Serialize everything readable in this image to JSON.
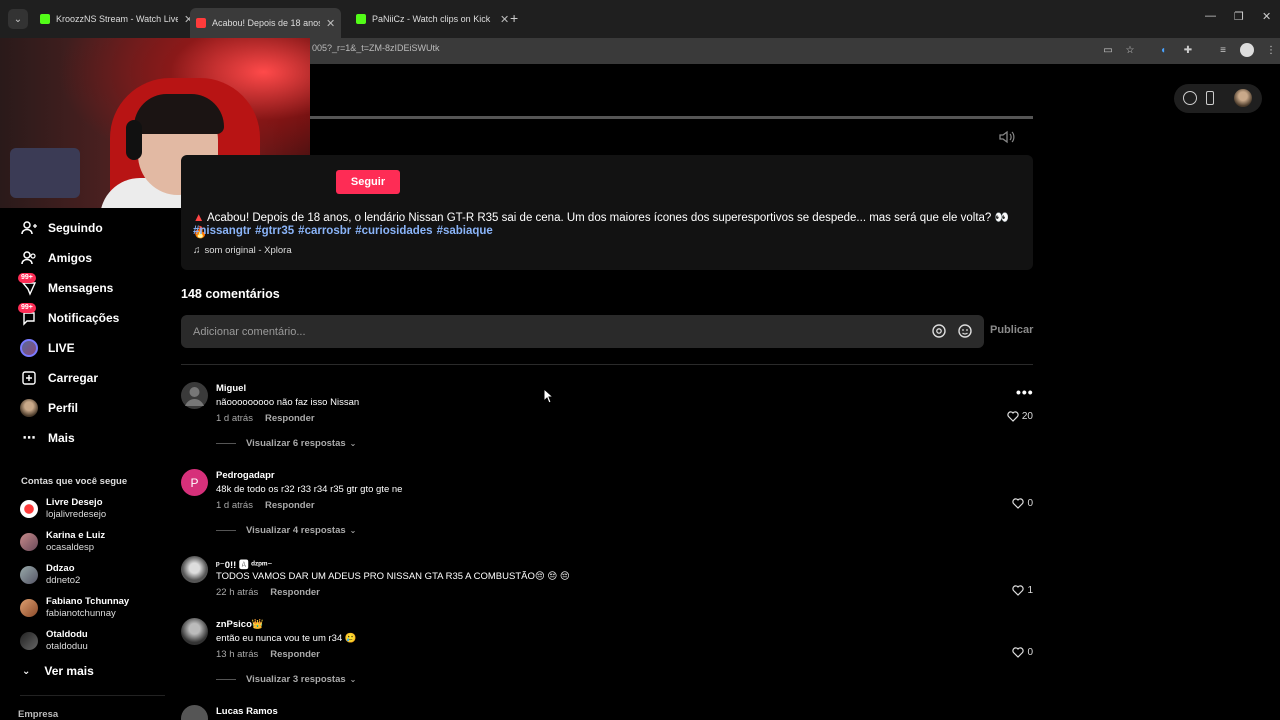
{
  "browser": {
    "tabs": [
      {
        "title": "KroozzNS Stream - Watch Live",
        "favicon_color": "#53fc18"
      },
      {
        "title": "Acabou! Depois de 18 anos",
        "favicon_color": "#ff3b3b"
      },
      {
        "title": "PaNiiCz - Watch clips on Kick",
        "favicon_color": "#53fc18"
      }
    ],
    "url": "005?_r=1&_t=ZM-8zIDEiSWUtk"
  },
  "sidebar": {
    "nav": [
      {
        "label": "Seguindo",
        "icon": "following-icon"
      },
      {
        "label": "Amigos",
        "icon": "friends-icon"
      },
      {
        "label": "Mensagens",
        "icon": "messages-icon",
        "badge": "99+"
      },
      {
        "label": "Notificações",
        "icon": "notifications-icon",
        "badge": "99+"
      },
      {
        "label": "LIVE",
        "icon": "live-icon"
      },
      {
        "label": "Carregar",
        "icon": "upload-icon"
      },
      {
        "label": "Perfil",
        "icon": "profile-icon"
      },
      {
        "label": "Mais",
        "icon": "more-icon"
      }
    ],
    "following_title": "Contas que você segue",
    "following": [
      {
        "name": "Livre Desejo",
        "handle": "lojalivredesejo"
      },
      {
        "name": "Karina e Luiz",
        "handle": "ocasaldesp"
      },
      {
        "name": "Ddzao",
        "handle": "ddneto2"
      },
      {
        "name": "Fabiano Tchunnay",
        "handle": "fabianotchunnay"
      },
      {
        "name": "Otaldodu",
        "handle": "otaldoduu"
      }
    ],
    "see_more": "Ver mais",
    "company": "Empresa"
  },
  "post": {
    "follow_label": "Seguir",
    "description": "Acabou! Depois de 18 anos, o lendário Nissan GT-R R35 sai de cena. Um dos maiores ícones dos superesportivos se despede... mas será que ele volta? 👀🔥",
    "hashtags": [
      "#nissangtr",
      "#gtrr35",
      "#carrosbr",
      "#curiosidades",
      "#sabiaque"
    ],
    "music": "som original - Xplora"
  },
  "comments_section": {
    "count_label": "148 comentários",
    "input_placeholder": "Adicionar comentário...",
    "publish_label": "Publicar",
    "reply_label": "Responder",
    "items": [
      {
        "name": "Miguel",
        "text": "nãooooooooo não faz isso Nissan",
        "time": "1 d atrás",
        "likes": "20",
        "replies": "Visualizar 6 respostas"
      },
      {
        "name": "Pedrogadapr",
        "text": "48k de todo os r32 r33 r34 r35 gtr gto gte ne",
        "time": "1 d atrás",
        "likes": "0",
        "replies": "Visualizar 4 respostas",
        "initial": "P"
      },
      {
        "name": "ᵖ⁻0!! 🅰 ᵈᶻᵖᵐ⁻",
        "text": "TODOS VAMOS DAR UM ADEUS PRO NISSAN GTA R35 A COMBUSTÃO😔 😔 😔",
        "time": "22 h atrás",
        "likes": "1"
      },
      {
        "name": "znPsico👑",
        "text": "então eu nunca vou te um r34 🥲",
        "time": "13 h atrás",
        "likes": "0",
        "replies": "Visualizar 3 respostas"
      },
      {
        "name": "Lucas Ramos"
      }
    ]
  },
  "colors": {
    "accent": "#fe2c55",
    "hashtag": "#8ab4f8"
  }
}
